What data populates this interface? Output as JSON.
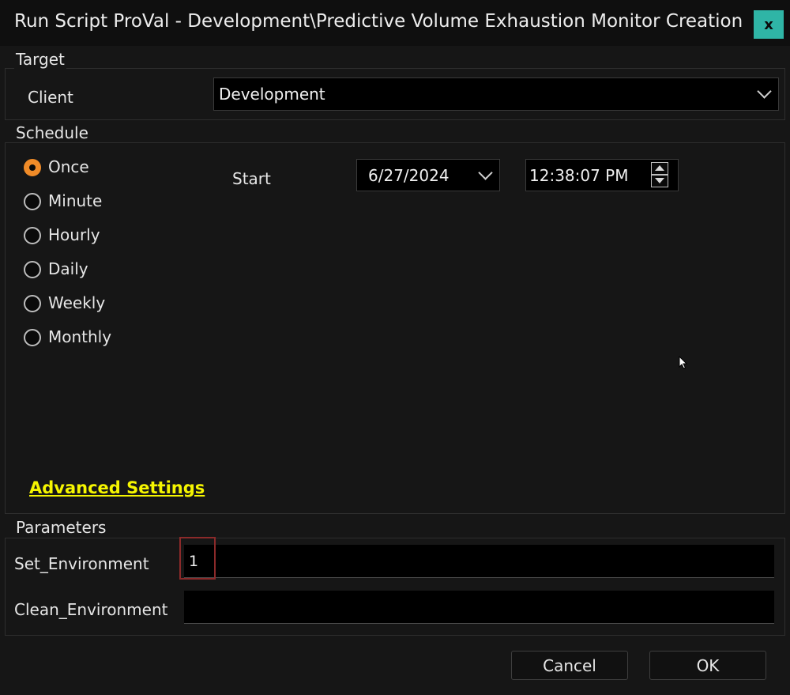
{
  "window": {
    "title": "Run Script ProVal - Development\\Predictive Volume Exhaustion Monitor Creation",
    "close_label": "x"
  },
  "target": {
    "group_label": "Target",
    "client_label": "Client",
    "client_value": "Development"
  },
  "schedule": {
    "group_label": "Schedule",
    "options": [
      {
        "label": "Once",
        "checked": true
      },
      {
        "label": "Minute",
        "checked": false
      },
      {
        "label": "Hourly",
        "checked": false
      },
      {
        "label": "Daily",
        "checked": false
      },
      {
        "label": "Weekly",
        "checked": false
      },
      {
        "label": "Monthly",
        "checked": false
      }
    ],
    "start_label": "Start",
    "start_date": "6/27/2024",
    "start_time": "12:38:07 PM",
    "advanced_settings_label": "Advanced Settings"
  },
  "parameters": {
    "group_label": "Parameters",
    "set_environment_label": "Set_Environment",
    "set_environment_value": "1",
    "clean_environment_label": "Clean_Environment",
    "clean_environment_value": ""
  },
  "buttons": {
    "cancel_label": "Cancel",
    "ok_label": "OK"
  },
  "colors": {
    "accent_close": "#2fb5a6",
    "radio_checked": "#f08b28",
    "link": "#f5f500",
    "focus_border": "#8b2a2a"
  }
}
